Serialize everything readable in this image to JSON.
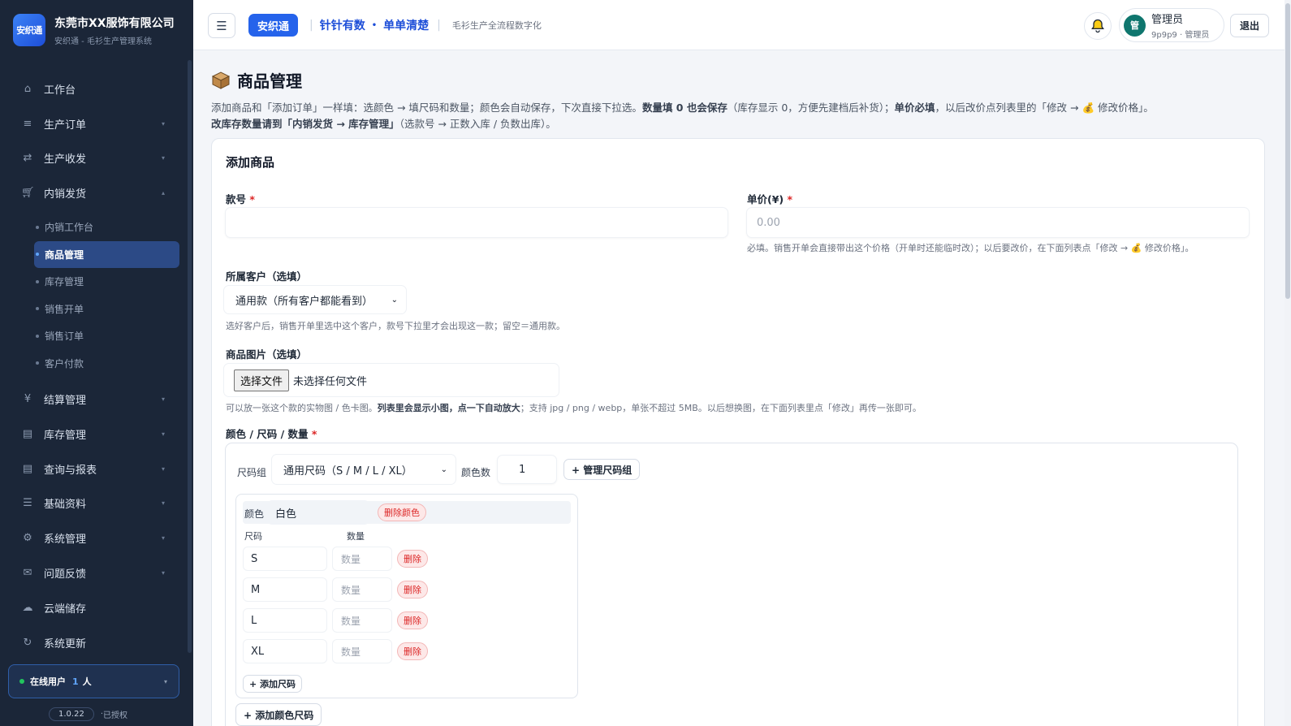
{
  "brand": {
    "logo_text": "安织通",
    "company": "东莞市XX服饰有限公司",
    "subtitle": "安织通 - 毛衫生产管理系统"
  },
  "sidebar": {
    "items": [
      {
        "label": "工作台",
        "icon": "home-icon"
      },
      {
        "label": "生产订单",
        "icon": "list-icon"
      },
      {
        "label": "生产收发",
        "icon": "swap-icon"
      },
      {
        "label": "内销发货",
        "icon": "cart-icon"
      }
    ],
    "sub_items": [
      "内销工作台",
      "商品管理",
      "库存管理",
      "销售开单",
      "销售订单",
      "客户付款"
    ],
    "items_after": [
      {
        "label": "结算管理",
        "icon": "yen-icon"
      },
      {
        "label": "库存管理",
        "icon": "box-list-icon"
      },
      {
        "label": "查询与报表",
        "icon": "report-icon"
      },
      {
        "label": "基础资料",
        "icon": "menu-icon"
      },
      {
        "label": "系统管理",
        "icon": "gear-icon"
      },
      {
        "label": "问题反馈",
        "icon": "mail-icon"
      },
      {
        "label": "云端储存",
        "icon": "cloud-icon"
      },
      {
        "label": "系统更新",
        "icon": "refresh-icon"
      }
    ],
    "online_label": "在线用户",
    "online_count": "1",
    "online_unit": "人",
    "version": "1.0.22",
    "license": "已授权"
  },
  "topbar": {
    "pill": "安织通",
    "slogan_a": "针针有数",
    "slogan_b": "单单清楚",
    "desc": "毛衫生产全流程数字化",
    "user_name": "管理员",
    "user_sub": "9p9p9 · 管理员",
    "avatar": "管",
    "logout": "退出"
  },
  "page": {
    "title": "商品管理",
    "intro_1": "添加商品和「添加订单」一样填：选颜色 → 填尺码和数量；颜色会自动保存，下次直接下拉选。",
    "intro_bold_1": "数量填 0 也会保存",
    "intro_2": "（库存显示 0，方便先建档后补货）；",
    "intro_bold_2": "单价必填",
    "intro_3": "，以后改价点列表里的「修改 → 💰 修改价格」。",
    "intro_bold_3": "改库存数量请到「内销发货 → 库存管理」",
    "intro_4": "（选款号 → 正数入库 / 负数出库）。"
  },
  "form": {
    "card_title": "添加商品",
    "style_label": "款号",
    "price_label": "单价(¥)",
    "price_placeholder": "0.00",
    "price_hint": "必填。销售开单会直接带出这个价格（开单时还能临时改）；以后要改价，在下面列表点「修改 → 💰 修改价格」。",
    "customer_label": "所属客户（选填）",
    "customer_value": "通用款（所有客户都能看到）",
    "customer_hint": "选好客户后，销售开单里选中这个客户，款号下拉里才会出现这一款；留空＝通用款。",
    "image_label": "商品图片（选填）",
    "file_button": "选择文件",
    "file_status": "未选择任何文件",
    "image_hint_1": "可以放一张这个款的实物图 / 色卡图。",
    "image_hint_bold": "列表里会显示小图，点一下自动放大",
    "image_hint_2": "；支持 jpg / png / webp，单张不超过 5MB。以后想换图，在下面列表里点「修改」再传一张即可。",
    "matrix_label": "颜色 / 尺码 / 数量"
  },
  "matrix": {
    "size_group_label": "尺码组",
    "size_group_value": "通用尺码（S / M / L / XL）",
    "color_count_label": "颜色数",
    "color_count_value": "1",
    "manage_button": "+ 管理尺码组",
    "color_label": "颜色",
    "color_value": "白色",
    "delete_color": "删除颜色",
    "size_header": "尺码",
    "qty_header": "数量",
    "rows": [
      {
        "size": "S",
        "qty_placeholder": "数量",
        "delete": "删除"
      },
      {
        "size": "M",
        "qty_placeholder": "数量",
        "delete": "删除"
      },
      {
        "size": "L",
        "qty_placeholder": "数量",
        "delete": "删除"
      },
      {
        "size": "XL",
        "qty_placeholder": "数量",
        "delete": "删除"
      }
    ],
    "add_size": "+ 添加尺码",
    "add_color_size": "+ 添加颜色尺码"
  },
  "colors": {
    "sidebar_bg": "#1b2638",
    "accent": "#2563eb",
    "danger": "#dc2626",
    "active_nav": "#2c4a86"
  }
}
